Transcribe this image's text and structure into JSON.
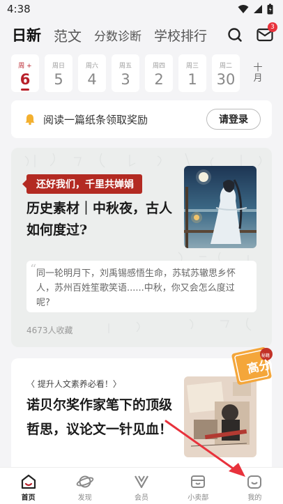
{
  "statusbar": {
    "time": "4:38"
  },
  "topnav": {
    "tabs": [
      {
        "label": "日新"
      },
      {
        "label": "范文"
      },
      {
        "label": "分数诊断"
      },
      {
        "label": "学校排行"
      }
    ],
    "mail_badge": "3"
  },
  "dates": [
    {
      "weekday": "周 +",
      "day": "6",
      "active": true
    },
    {
      "weekday": "周日",
      "day": "5"
    },
    {
      "weekday": "周六",
      "day": "4"
    },
    {
      "weekday": "周五",
      "day": "3"
    },
    {
      "weekday": "周四",
      "day": "2"
    },
    {
      "weekday": "周三",
      "day": "1"
    },
    {
      "weekday": "周二",
      "day": "30"
    }
  ],
  "month_label": "十月",
  "login_banner": {
    "message": "阅读一篇纸条领取奖励",
    "button": "请登录"
  },
  "article1": {
    "tagline": "还好我们，千里共婵娟",
    "title": "历史素材｜中秋夜，古人如何度过?",
    "quote": "同一轮明月下，刘禹锡感悟生命，苏轼苏辙思乡怀人，苏州百姓笙歌笑语......中秋，你又会怎么度过呢?",
    "saves": "4673人收藏"
  },
  "article2": {
    "subtag": "〈 提升人文素养必看！〉",
    "title": "诺贝尔奖作家笔下的顶级哲思，议论文一针见血！",
    "seal_text": "高分",
    "seal_small": "秘籍"
  },
  "bottomnav": [
    {
      "label": "首页",
      "icon": "home-icon",
      "active": true
    },
    {
      "label": "发现",
      "icon": "planet-icon"
    },
    {
      "label": "会员",
      "icon": "vip-icon"
    },
    {
      "label": "小卖部",
      "icon": "shop-icon"
    },
    {
      "label": "我的",
      "icon": "profile-icon"
    }
  ],
  "colors": {
    "accent": "#b8202a",
    "tag_red": "#b32a22",
    "arrow": "#e8323c"
  }
}
